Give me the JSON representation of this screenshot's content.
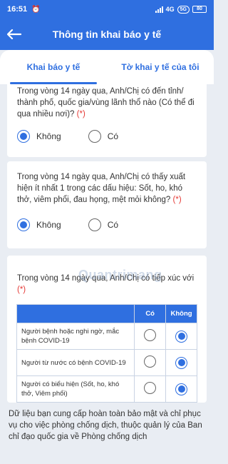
{
  "statusbar": {
    "time": "16:51",
    "network": "4G",
    "wifi": "5G",
    "battery": "80"
  },
  "header": {
    "title": "Thông tin khai báo y tế"
  },
  "tabs": [
    {
      "label": "Khai báo y tế",
      "active": true
    },
    {
      "label": "Tờ khai y tế của tôi",
      "active": false
    }
  ],
  "q1": {
    "text": "Trong vòng 14 ngày qua, Anh/Chị có đến tỉnh/ thành phố, quốc gia/vùng lãnh thổ nào (Có thể đi qua nhiều nơi)?",
    "required_mark": "(*)",
    "options": [
      "Không",
      "Có"
    ],
    "selected": "Không"
  },
  "q2": {
    "text": "Trong vòng 14 ngày qua, Anh/Chị có thấy xuất hiện ít nhất 1 trong các dấu hiệu: Sốt, ho, khó thở, viêm phổi, đau họng, mệt mỏi không?",
    "required_mark": "(*)",
    "options": [
      "Không",
      "Có"
    ],
    "selected": "Không"
  },
  "q3": {
    "text": "Trong vòng 14 ngày qua, Anh/Chị có tiếp xúc với",
    "required_mark": "(*)",
    "table": {
      "headers": [
        "",
        "Có",
        "Không"
      ],
      "rows": [
        {
          "label": "Người bệnh hoặc nghi ngờ, mắc bệnh COVID-19",
          "selected": "Không"
        },
        {
          "label": "Người từ nước có bệnh COVID-19",
          "selected": "Không"
        },
        {
          "label": "Người có biểu hiện (Sốt, ho, khó thở, Viêm phổi)",
          "selected": "Không"
        }
      ]
    }
  },
  "watermark": "Quantrimang",
  "footer": {
    "text": "Dữ liệu bạn cung cấp hoàn toàn bảo mật và chỉ phục vụ cho việc phòng chống dịch, thuộc quản lý của Ban chỉ đạo quốc gia về Phòng chống dịch"
  },
  "colors": {
    "primary": "#2f6fe0",
    "required": "#e53935",
    "background": "#e9edf3"
  }
}
